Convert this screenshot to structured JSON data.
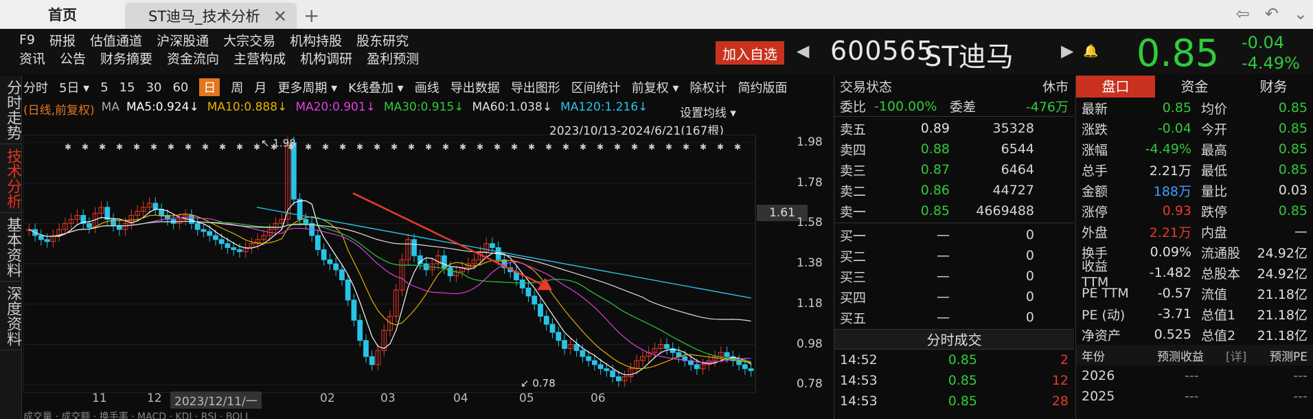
{
  "tabbar": {
    "home": "首页",
    "active_tab": "ST迪马_技术分析",
    "close": "✕",
    "plus": "+",
    "back": "⇦",
    "undo": "↶",
    "menu": "⌄"
  },
  "menu": {
    "row1": [
      "F9",
      "研报",
      "估值通道",
      "沪深股通",
      "大宗交易",
      "机构持股",
      "股东研究"
    ],
    "row2": [
      "资讯",
      "公告",
      "财务摘要",
      "资金流向",
      "主营构成",
      "机构调研",
      "盈利预测"
    ]
  },
  "header": {
    "add_watch": "加入自选",
    "code": "600565",
    "name": "ST迪马",
    "price": "0.85",
    "change": "-0.04",
    "change_pct": "-4.49%"
  },
  "side": [
    "分时走势",
    "技术分析",
    "基本资料",
    "深度资料"
  ],
  "toolbar": [
    "分时",
    "5日 ▾",
    "5",
    "15",
    "30",
    "60",
    "日",
    "周",
    "月",
    "更多周期 ▾",
    "K线叠加 ▾",
    "画线",
    "导出数据",
    "导出图形",
    "区间统计",
    "前复权 ▾",
    "除权计",
    "简约版面"
  ],
  "ma": {
    "label": "(日线,前复权)",
    "ma_label": "MA",
    "items": [
      {
        "t": "MA5:0.924↓",
        "c": "#ffffff"
      },
      {
        "t": "MA10:0.888↓",
        "c": "#e8b000"
      },
      {
        "t": "MA20:0.901↓",
        "c": "#e040e0"
      },
      {
        "t": "MA30:0.915↓",
        "c": "#2ecc3a"
      },
      {
        "t": "MA60:1.038↓",
        "c": "#e0e0e0"
      },
      {
        "t": "MA120:1.216↓",
        "c": "#27c4e8"
      }
    ],
    "setting": "设置均线 ▾",
    "range": "2023/10/13-2024/6/21(167根)"
  },
  "yaxis": [
    "1.98",
    "1.78",
    "1.58",
    "1.38",
    "1.18",
    "0.98",
    "0.78"
  ],
  "current_price_label": "1.61",
  "high_label": "1.98",
  "low_label": "0.78",
  "xaxis": [
    "11",
    "12",
    "2023/12/11/一",
    "02",
    "03",
    "04",
    "05",
    "06"
  ],
  "chart_data": {
    "type": "candlestick",
    "ylim": [
      0.74,
      2.02
    ],
    "ma120_start": 1.66,
    "ma120_end": 1.21
  },
  "quote": {
    "status_label": "交易状态",
    "status_val": "休市",
    "weibi_label": "委比",
    "weibi_val": "-100.00%",
    "weicha_label": "委差",
    "weicha_val": "-476万",
    "sell": [
      {
        "l": "卖五",
        "p": "0.89",
        "v": "35328",
        "c": "w"
      },
      {
        "l": "卖四",
        "p": "0.88",
        "v": "6544",
        "c": "g"
      },
      {
        "l": "卖三",
        "p": "0.87",
        "v": "6464",
        "c": "g"
      },
      {
        "l": "卖二",
        "p": "0.86",
        "v": "44727",
        "c": "g"
      },
      {
        "l": "卖一",
        "p": "0.85",
        "v": "4669488",
        "c": "g"
      }
    ],
    "buy": [
      {
        "l": "买一",
        "p": "—",
        "v": "0"
      },
      {
        "l": "买二",
        "p": "—",
        "v": "0"
      },
      {
        "l": "买三",
        "p": "—",
        "v": "0"
      },
      {
        "l": "买四",
        "p": "—",
        "v": "0"
      },
      {
        "l": "买五",
        "p": "—",
        "v": "0"
      }
    ],
    "ticks_title": "分时成交",
    "ticks": [
      {
        "t": "14:52",
        "p": "0.85",
        "v": "2"
      },
      {
        "t": "14:53",
        "p": "0.85",
        "v": "12"
      },
      {
        "t": "14:53",
        "p": "0.85",
        "v": "28"
      }
    ]
  },
  "panel": {
    "tabs": [
      "盘口",
      "资金",
      "财务"
    ],
    "rows": [
      [
        "最新",
        "0.85",
        "g",
        "均价",
        "0.85",
        "g"
      ],
      [
        "涨跌",
        "-0.04",
        "g",
        "今开",
        "0.85",
        "g"
      ],
      [
        "涨幅",
        "-4.49%",
        "g",
        "最高",
        "0.85",
        "g"
      ],
      [
        "总手",
        "2.21万",
        "w",
        "最低",
        "0.85",
        "g"
      ],
      [
        "金额",
        "188万",
        "b",
        "量比",
        "0.03",
        "w"
      ],
      [
        "涨停",
        "0.93",
        "r",
        "跌停",
        "0.85",
        "g"
      ],
      [
        "外盘",
        "2.21万",
        "r",
        "内盘",
        "—",
        "w"
      ],
      [
        "换手",
        "0.09%",
        "w",
        "流通股",
        "24.92亿",
        "w"
      ],
      [
        "收益TTM",
        "-1.482",
        "w",
        "总股本",
        "24.92亿",
        "w"
      ],
      [
        "PE TTM",
        "-0.57",
        "w",
        "流值",
        "21.18亿",
        "w"
      ],
      [
        "PE (动)",
        "-3.71",
        "w",
        "总值1",
        "21.18亿",
        "w"
      ],
      [
        "净资产",
        "0.525",
        "w",
        "总值2",
        "21.18亿",
        "w"
      ]
    ],
    "forecast_hdr": [
      "年份",
      "预测收益",
      "[详]",
      "预测PE"
    ],
    "forecast": [
      [
        "2026",
        "---",
        "---"
      ],
      [
        "2025",
        "---",
        "---"
      ]
    ]
  }
}
